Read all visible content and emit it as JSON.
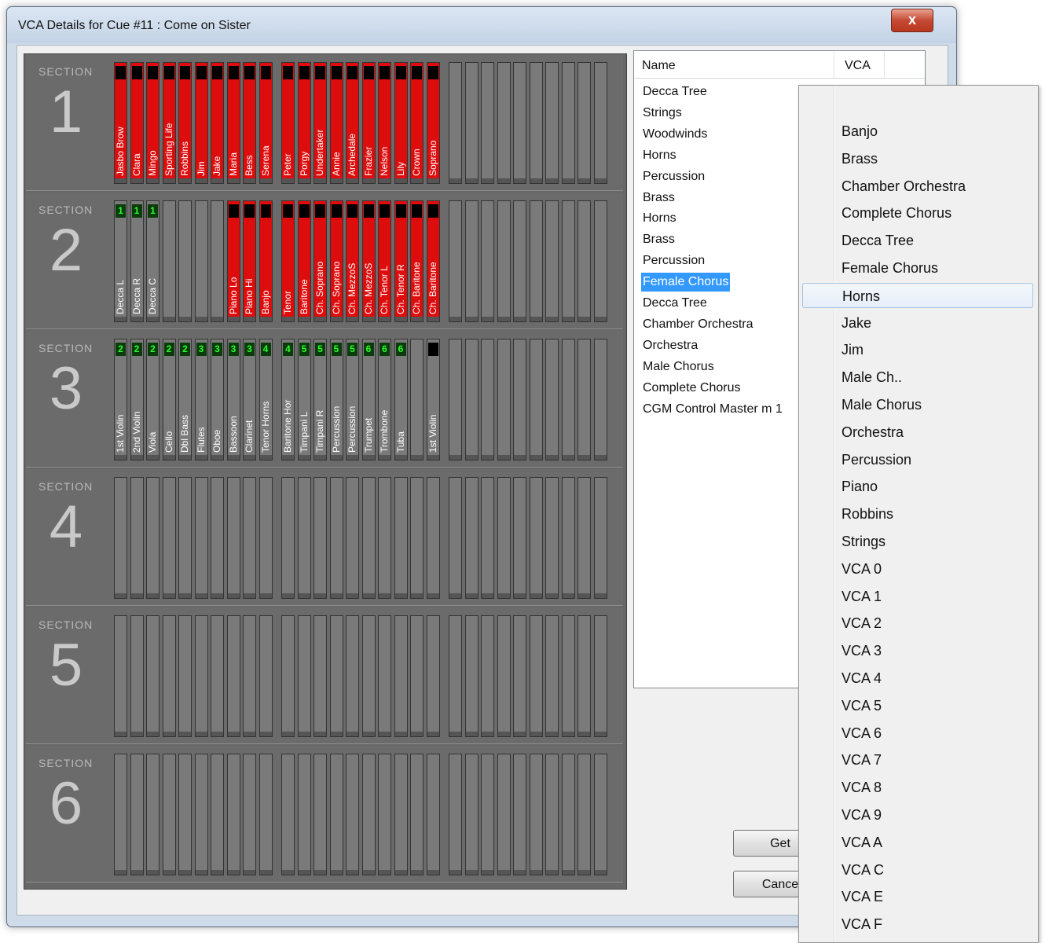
{
  "window": {
    "title": "VCA Details for Cue #11 : Come on Sister",
    "close_label": "x"
  },
  "section_label": "SECTION",
  "sections": [
    {
      "number": "1",
      "strips": [
        {
          "label": "Jasbo Brow",
          "red": true,
          "header": "",
          "hdr": "blk"
        },
        {
          "label": "Clara",
          "red": true,
          "header": "",
          "hdr": "blk"
        },
        {
          "label": "Mingo",
          "red": true,
          "header": "",
          "hdr": "blk"
        },
        {
          "label": "Sporting Life",
          "red": true,
          "header": "",
          "hdr": "blk"
        },
        {
          "label": "Robbins",
          "red": true,
          "header": "",
          "hdr": "blk"
        },
        {
          "label": "Jim",
          "red": true,
          "header": "",
          "hdr": "blk"
        },
        {
          "label": "Jake",
          "red": true,
          "header": "",
          "hdr": "blk"
        },
        {
          "label": "Maria",
          "red": true,
          "header": "",
          "hdr": "blk"
        },
        {
          "label": "Bess",
          "red": true,
          "header": "",
          "hdr": "blk"
        },
        {
          "label": "Serena",
          "red": true,
          "header": "",
          "hdr": "blk"
        },
        {
          "label": "Peter",
          "red": true,
          "header": "",
          "hdr": "blk"
        },
        {
          "label": "Porgy",
          "red": true,
          "header": "",
          "hdr": "blk"
        },
        {
          "label": "Undertaker",
          "red": true,
          "header": "",
          "hdr": "blk"
        },
        {
          "label": "Annie",
          "red": true,
          "header": "",
          "hdr": "blk"
        },
        {
          "label": "Archedale",
          "red": true,
          "header": "",
          "hdr": "blk"
        },
        {
          "label": "Frazier",
          "red": true,
          "header": "",
          "hdr": "blk"
        },
        {
          "label": "Nelson",
          "red": true,
          "header": "",
          "hdr": "blk"
        },
        {
          "label": "Lily",
          "red": true,
          "header": "",
          "hdr": "blk"
        },
        {
          "label": "Crown",
          "red": true,
          "header": "",
          "hdr": "blk"
        },
        {
          "label": "Soprano",
          "red": true,
          "header": "",
          "hdr": "blk"
        }
      ]
    },
    {
      "number": "2",
      "strips": [
        {
          "label": "Decca L",
          "red": false,
          "header": "1",
          "hdr": "num"
        },
        {
          "label": "Decca R",
          "red": false,
          "header": "1",
          "hdr": "num"
        },
        {
          "label": "Decca C",
          "red": false,
          "header": "1",
          "hdr": "num"
        },
        {
          "label": "",
          "red": false,
          "header": "",
          "hdr": "none"
        },
        {
          "label": "",
          "red": false,
          "header": "",
          "hdr": "none"
        },
        {
          "label": "",
          "red": false,
          "header": "",
          "hdr": "none"
        },
        {
          "label": "",
          "red": false,
          "header": "",
          "hdr": "none"
        },
        {
          "label": "Piano Lo",
          "red": true,
          "header": "",
          "hdr": "blk"
        },
        {
          "label": "Piano Hi",
          "red": true,
          "header": "",
          "hdr": "blk"
        },
        {
          "label": "Banjo",
          "red": true,
          "header": "",
          "hdr": "blk"
        },
        {
          "label": "Tenor",
          "red": true,
          "header": "",
          "hdr": "blk"
        },
        {
          "label": "Baritone",
          "red": true,
          "header": "",
          "hdr": "blk"
        },
        {
          "label": "Ch. Soprano",
          "red": true,
          "header": "",
          "hdr": "blk"
        },
        {
          "label": "Ch. Soprano",
          "red": true,
          "header": "",
          "hdr": "blk"
        },
        {
          "label": "Ch. MezzoS",
          "red": true,
          "header": "",
          "hdr": "blk"
        },
        {
          "label": "Ch. MezzoS",
          "red": true,
          "header": "",
          "hdr": "blk"
        },
        {
          "label": "Ch. Tenor L",
          "red": true,
          "header": "",
          "hdr": "blk"
        },
        {
          "label": "Ch. Tenor R",
          "red": true,
          "header": "",
          "hdr": "blk"
        },
        {
          "label": "Ch. Baritone",
          "red": true,
          "header": "",
          "hdr": "blk"
        },
        {
          "label": "Ch. Baritone",
          "red": true,
          "header": "",
          "hdr": "blk"
        }
      ]
    },
    {
      "number": "3",
      "strips": [
        {
          "label": "1st Violin",
          "red": false,
          "header": "2",
          "hdr": "num"
        },
        {
          "label": "2nd Violin",
          "red": false,
          "header": "2",
          "hdr": "num"
        },
        {
          "label": "Viola",
          "red": false,
          "header": "2",
          "hdr": "num"
        },
        {
          "label": "Cello",
          "red": false,
          "header": "2",
          "hdr": "num"
        },
        {
          "label": "Dbl Bass",
          "red": false,
          "header": "2",
          "hdr": "num"
        },
        {
          "label": "Flutes",
          "red": false,
          "header": "3",
          "hdr": "num"
        },
        {
          "label": "Oboe",
          "red": false,
          "header": "3",
          "hdr": "num"
        },
        {
          "label": "Bassoon",
          "red": false,
          "header": "3",
          "hdr": "num"
        },
        {
          "label": "Clarinet",
          "red": false,
          "header": "3",
          "hdr": "num"
        },
        {
          "label": "Tenor Horns",
          "red": false,
          "header": "4",
          "hdr": "num"
        },
        {
          "label": "Baritone Hor",
          "red": false,
          "header": "4",
          "hdr": "num"
        },
        {
          "label": "Timpani L",
          "red": false,
          "header": "5",
          "hdr": "num"
        },
        {
          "label": "Timpani R",
          "red": false,
          "header": "5",
          "hdr": "num"
        },
        {
          "label": "Percussion",
          "red": false,
          "header": "5",
          "hdr": "num"
        },
        {
          "label": "Percussion",
          "red": false,
          "header": "5",
          "hdr": "num"
        },
        {
          "label": "Trumpet",
          "red": false,
          "header": "6",
          "hdr": "num"
        },
        {
          "label": "Trombone",
          "red": false,
          "header": "6",
          "hdr": "num"
        },
        {
          "label": "Tuba",
          "red": false,
          "header": "6",
          "hdr": "num"
        },
        {
          "label": "",
          "red": false,
          "header": "",
          "hdr": "none"
        },
        {
          "label": "1st Violin",
          "red": false,
          "header": "",
          "hdr": "blk"
        }
      ]
    },
    {
      "number": "4",
      "strips": []
    },
    {
      "number": "5",
      "strips": []
    },
    {
      "number": "6",
      "strips": []
    }
  ],
  "list": {
    "col_name": "Name",
    "col_vca": "VCA",
    "rows": [
      "Decca Tree",
      "Strings",
      "Woodwinds",
      "Horns",
      "Percussion",
      "Brass",
      "Horns",
      "Brass",
      "Percussion",
      "Female Chorus",
      "Decca Tree",
      "Chamber Orchestra",
      "Orchestra",
      "Male Chorus",
      "Complete Chorus",
      "CGM  Control Master m 1"
    ],
    "selected_index": 9
  },
  "buttons": {
    "get": "Get",
    "cancel": "Cance"
  },
  "dropdown": {
    "items": [
      "Banjo",
      "Brass",
      "Chamber Orchestra",
      "Complete Chorus",
      "Decca Tree",
      "Female Chorus",
      "Horns",
      "Jake",
      "Jim",
      "Male Ch..",
      "Male Chorus",
      "Orchestra",
      "Percussion",
      "Piano",
      "Robbins",
      "Strings",
      "VCA 0",
      "VCA 1",
      "VCA 2",
      "VCA 3",
      "VCA 4",
      "VCA 5",
      "VCA 6",
      "VCA 7",
      "VCA 8",
      "VCA 9",
      "VCA A",
      "VCA C",
      "VCA E",
      "VCA F"
    ],
    "hover_index": 6
  }
}
